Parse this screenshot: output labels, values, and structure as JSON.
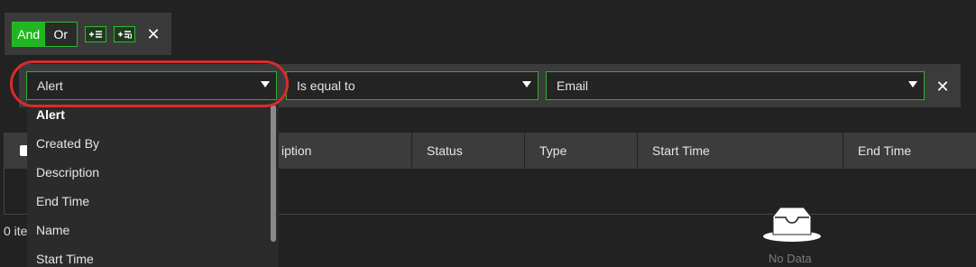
{
  "toolbar": {
    "and_label": "And",
    "or_label": "Or",
    "add_condition_icon": "add-condition-icon",
    "add_group_icon": "add-group-icon",
    "remove_group_icon": "close-icon"
  },
  "condition": {
    "field_value": "Alert",
    "operator_value": "Is equal to",
    "value_value": "Email",
    "remove_icon": "close-icon"
  },
  "dropdown": {
    "items": [
      "Alert",
      "Created By",
      "Description",
      "End Time",
      "Name",
      "Start Time"
    ],
    "selected": "Alert"
  },
  "table": {
    "columns": [
      "iption",
      "Status",
      "Type",
      "Start Time",
      "End Time"
    ],
    "items_count": "0 ite",
    "empty_text": "No Data"
  },
  "colors": {
    "accent": "#1fb71f",
    "border_accent": "#30b030",
    "annotation": "#d92b2b",
    "background": "#222222"
  }
}
